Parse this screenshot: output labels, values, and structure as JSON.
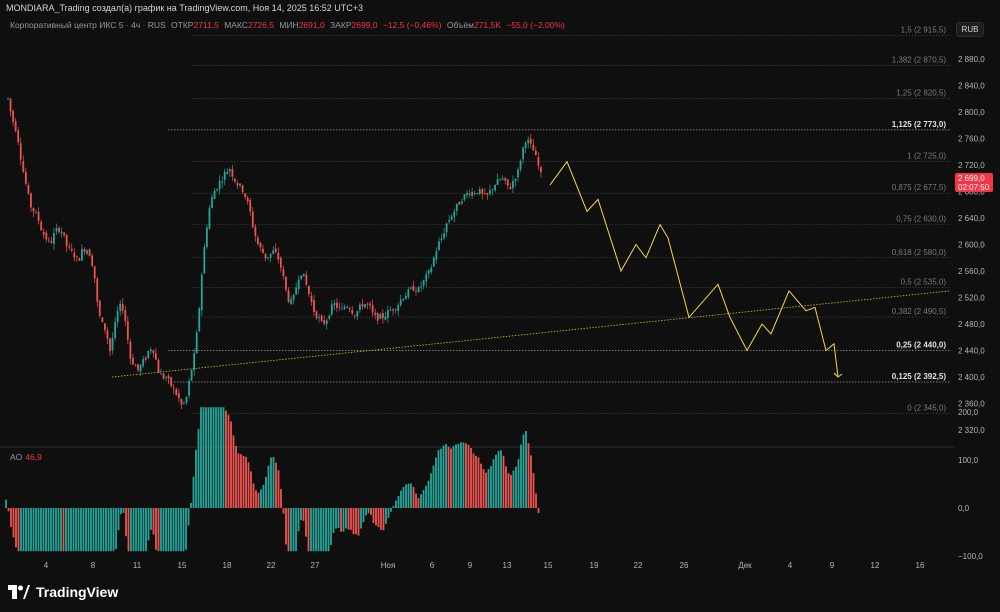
{
  "header": {
    "title": "MONDIARA_Trading создал(а) график на TradingView.com, Ноя 14, 2025 16:52 UTC+3"
  },
  "legend": {
    "symbol": "Корпоративный центр ИКС 5 · 4ч · RUS",
    "open_label": "ОТКР",
    "open_value": "2711,5",
    "high_label": "МАКС",
    "high_value": "2726,5",
    "low_label": "МИН",
    "low_value": "2691,0",
    "close_label": "ЗАКР",
    "close_value": "2699,0",
    "change": "−12,5 (−0,46%)",
    "volume_label": "Объём",
    "volume_value": "271,5K",
    "volume_change": "−55,0 (−2,00%)"
  },
  "currency": "RUB",
  "price_tag": {
    "price": "2 699,0",
    "timer": "02:07:50"
  },
  "ao": {
    "label": "AO",
    "value": "46,9"
  },
  "brand": "TradingView",
  "colors": {
    "up": "#26a69a",
    "down": "#ef5350",
    "projection": "#f5d742",
    "trendline": "#d4b93c",
    "background": "#0f0f0f"
  },
  "chart_data": {
    "type": "candlestick",
    "price_axis": {
      "min": 2300,
      "max": 2940,
      "ticks": [
        "2 880,0",
        "2 840,0",
        "2 800,0",
        "2 760,0",
        "2 720,0",
        "2 680,0",
        "2 640,0",
        "2 600,0",
        "2 560,0",
        "2 520,0",
        "2 480,0",
        "2 440,0",
        "2 400,0",
        "2 360,0",
        "2 320,0"
      ],
      "tick_values": [
        2880,
        2840,
        2800,
        2760,
        2720,
        2680,
        2640,
        2600,
        2560,
        2520,
        2480,
        2440,
        2400,
        2360,
        2320
      ]
    },
    "time_axis": {
      "labels": [
        "4",
        "8",
        "11",
        "15",
        "18",
        "22",
        "27",
        "Ноя",
        "6",
        "9",
        "13",
        "15",
        "19",
        "22",
        "26",
        "Дек",
        "4",
        "9",
        "12",
        "16"
      ]
    },
    "fib_levels": [
      {
        "ratio": "1,5",
        "price": 2915.5,
        "label": "1,5 (2 915,5)",
        "bold": false
      },
      {
        "ratio": "1,382",
        "price": 2870.5,
        "label": "1,382 (2 870,5)",
        "bold": false
      },
      {
        "ratio": "1,25",
        "price": 2820.5,
        "label": "1,25 (2 820,5)",
        "bold": false
      },
      {
        "ratio": "1,125",
        "price": 2773.0,
        "label": "1,125 (2 773,0)",
        "bold": true
      },
      {
        "ratio": "1",
        "price": 2725.0,
        "label": "1 (2 725,0)",
        "bold": false
      },
      {
        "ratio": "0,875",
        "price": 2677.5,
        "label": "0,875 (2 677,5)",
        "bold": false
      },
      {
        "ratio": "0,75",
        "price": 2630.0,
        "label": "0,75 (2 630,0)",
        "bold": false
      },
      {
        "ratio": "0,618",
        "price": 2580.0,
        "label": "0,618 (2 580,0)",
        "bold": false
      },
      {
        "ratio": "0,5",
        "price": 2535.0,
        "label": "0,5 (2 535,0)",
        "bold": false
      },
      {
        "ratio": "0,382",
        "price": 2490.5,
        "label": "0,382 (2 490,5)",
        "bold": false
      },
      {
        "ratio": "0,25",
        "price": 2440.0,
        "label": "0,25 (2 440,0)",
        "bold": true
      },
      {
        "ratio": "0,125",
        "price": 2392.5,
        "label": "0,125 (2 392,5)",
        "bold": true
      },
      {
        "ratio": "0",
        "price": 2345.0,
        "label": "0 (2 345,0)",
        "bold": false
      }
    ],
    "price_path": [
      [
        0,
        2880
      ],
      [
        4,
        2840
      ],
      [
        8,
        2820
      ],
      [
        12,
        2790
      ],
      [
        15,
        2780
      ],
      [
        18,
        2760
      ],
      [
        22,
        2720
      ],
      [
        26,
        2690
      ],
      [
        30,
        2660
      ],
      [
        34,
        2650
      ],
      [
        38,
        2640
      ],
      [
        42,
        2620
      ],
      [
        46,
        2610
      ],
      [
        50,
        2600
      ],
      [
        54,
        2615
      ],
      [
        58,
        2625
      ],
      [
        62,
        2620
      ],
      [
        66,
        2600
      ],
      [
        70,
        2590
      ],
      [
        74,
        2585
      ],
      [
        78,
        2575
      ],
      [
        82,
        2590
      ],
      [
        86,
        2595
      ],
      [
        90,
        2585
      ],
      [
        94,
        2560
      ],
      [
        98,
        2500
      ],
      [
        102,
        2480
      ],
      [
        106,
        2470
      ],
      [
        110,
        2440
      ],
      [
        114,
        2470
      ],
      [
        118,
        2500
      ],
      [
        122,
        2510
      ],
      [
        126,
        2480
      ],
      [
        130,
        2430
      ],
      [
        134,
        2420
      ],
      [
        138,
        2410
      ],
      [
        142,
        2420
      ],
      [
        146,
        2430
      ],
      [
        150,
        2445
      ],
      [
        154,
        2440
      ],
      [
        158,
        2410
      ],
      [
        162,
        2400
      ],
      [
        166,
        2400
      ],
      [
        170,
        2390
      ],
      [
        174,
        2380
      ],
      [
        178,
        2370
      ],
      [
        182,
        2355
      ],
      [
        186,
        2365
      ],
      [
        190,
        2400
      ],
      [
        194,
        2430
      ],
      [
        198,
        2480
      ],
      [
        202,
        2560
      ],
      [
        206,
        2620
      ],
      [
        210,
        2660
      ],
      [
        214,
        2680
      ],
      [
        218,
        2690
      ],
      [
        222,
        2700
      ],
      [
        226,
        2710
      ],
      [
        230,
        2715
      ],
      [
        234,
        2700
      ],
      [
        238,
        2690
      ],
      [
        242,
        2685
      ],
      [
        246,
        2670
      ],
      [
        250,
        2650
      ],
      [
        254,
        2620
      ],
      [
        258,
        2600
      ],
      [
        262,
        2590
      ],
      [
        266,
        2580
      ],
      [
        270,
        2585
      ],
      [
        274,
        2590
      ],
      [
        278,
        2580
      ],
      [
        282,
        2560
      ],
      [
        286,
        2530
      ],
      [
        290,
        2510
      ],
      [
        294,
        2520
      ],
      [
        298,
        2550
      ],
      [
        302,
        2560
      ],
      [
        306,
        2540
      ],
      [
        310,
        2520
      ],
      [
        314,
        2500
      ],
      [
        318,
        2490
      ],
      [
        322,
        2480
      ],
      [
        326,
        2485
      ],
      [
        330,
        2500
      ],
      [
        334,
        2510
      ],
      [
        338,
        2505
      ],
      [
        342,
        2500
      ],
      [
        346,
        2510
      ],
      [
        350,
        2505
      ],
      [
        354,
        2495
      ],
      [
        358,
        2500
      ],
      [
        362,
        2510
      ],
      [
        366,
        2510
      ],
      [
        370,
        2505
      ],
      [
        374,
        2490
      ],
      [
        378,
        2490
      ],
      [
        382,
        2490
      ],
      [
        386,
        2495
      ],
      [
        390,
        2500
      ],
      [
        394,
        2505
      ],
      [
        398,
        2510
      ],
      [
        402,
        2520
      ],
      [
        406,
        2525
      ],
      [
        410,
        2530
      ],
      [
        414,
        2535
      ],
      [
        418,
        2530
      ],
      [
        422,
        2540
      ],
      [
        426,
        2550
      ],
      [
        430,
        2560
      ],
      [
        434,
        2580
      ],
      [
        438,
        2600
      ],
      [
        442,
        2610
      ],
      [
        446,
        2630
      ],
      [
        450,
        2640
      ],
      [
        454,
        2650
      ],
      [
        458,
        2660
      ],
      [
        462,
        2670
      ],
      [
        466,
        2675
      ],
      [
        470,
        2680
      ],
      [
        474,
        2678
      ],
      [
        478,
        2682
      ],
      [
        482,
        2675
      ],
      [
        486,
        2670
      ],
      [
        490,
        2680
      ],
      [
        494,
        2690
      ],
      [
        498,
        2695
      ],
      [
        502,
        2700
      ],
      [
        506,
        2690
      ],
      [
        510,
        2685
      ],
      [
        514,
        2700
      ],
      [
        518,
        2710
      ],
      [
        522,
        2740
      ],
      [
        526,
        2760
      ],
      [
        530,
        2750
      ],
      [
        534,
        2740
      ],
      [
        538,
        2720
      ],
      [
        542,
        2699
      ]
    ],
    "projection_path": [
      [
        550,
        2690
      ],
      [
        567,
        2725
      ],
      [
        587,
        2650
      ],
      [
        598,
        2668
      ],
      [
        621,
        2560
      ],
      [
        636,
        2600
      ],
      [
        646,
        2580
      ],
      [
        660,
        2630
      ],
      [
        668,
        2610
      ],
      [
        689,
        2490
      ],
      [
        718,
        2540
      ],
      [
        730,
        2490
      ],
      [
        747,
        2440
      ],
      [
        762,
        2480
      ],
      [
        771,
        2465
      ],
      [
        789,
        2530
      ],
      [
        806,
        2500
      ],
      [
        815,
        2505
      ],
      [
        826,
        2440
      ],
      [
        834,
        2450
      ],
      [
        838,
        2400
      ]
    ],
    "trendline": {
      "from": [
        112,
        2400
      ],
      "to": [
        950,
        2530
      ]
    },
    "ao_axis": {
      "ticks": [
        "200,0",
        "100,0",
        "0,0",
        "−100,0"
      ],
      "tick_values": [
        200,
        100,
        0,
        -100
      ]
    }
  }
}
